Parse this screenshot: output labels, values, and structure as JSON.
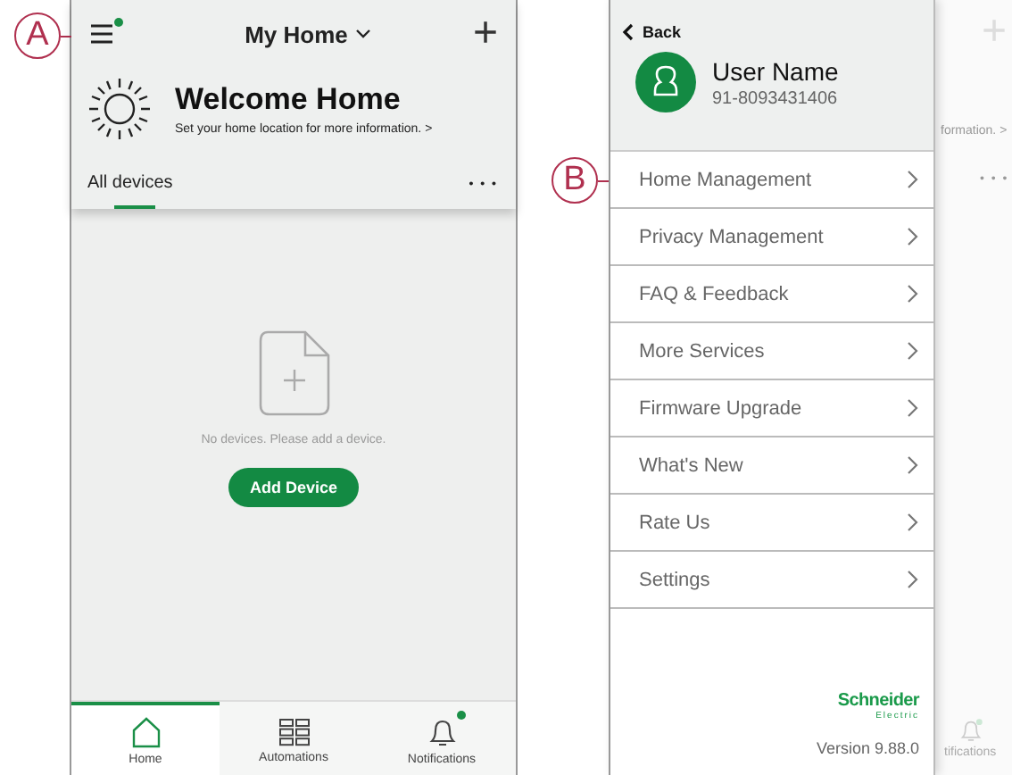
{
  "callouts": [
    {
      "label": "A"
    },
    {
      "label": "B"
    }
  ],
  "home_screen": {
    "header": {
      "menu_badge": true,
      "title": "My Home",
      "add": "+"
    },
    "welcome": {
      "title": "Welcome Home",
      "subtitle": "Set your home location for more information. >"
    },
    "tabs": [
      {
        "label": "All devices",
        "selected": true
      }
    ],
    "more": "• • •",
    "empty": {
      "message": "No devices. Please add a device.",
      "button": "Add Device"
    },
    "nav": [
      {
        "kind": "home",
        "label": "Home",
        "selected": true,
        "badge": false
      },
      {
        "kind": "automations",
        "label": "Automations",
        "selected": false,
        "badge": false
      },
      {
        "kind": "notifications",
        "label": "Notifications",
        "selected": false,
        "badge": true
      }
    ]
  },
  "side_menu": {
    "back": "Back",
    "user": {
      "name": "User Name",
      "phone": "91-8093431406"
    },
    "items": [
      {
        "label": "Home Management"
      },
      {
        "label": "Privacy Management"
      },
      {
        "label": "FAQ & Feedback"
      },
      {
        "label": "More Services"
      },
      {
        "label": "Firmware Upgrade"
      },
      {
        "label": "What's New"
      },
      {
        "label": "Rate Us"
      },
      {
        "label": "Settings"
      }
    ],
    "brand": {
      "name": "Schneider",
      "sub": "Electric"
    },
    "version": "Version 9.88.0"
  },
  "background_screen": {
    "add": "+",
    "subtitle": "formation. >",
    "more": "• • •",
    "nav_label": "tifications"
  }
}
